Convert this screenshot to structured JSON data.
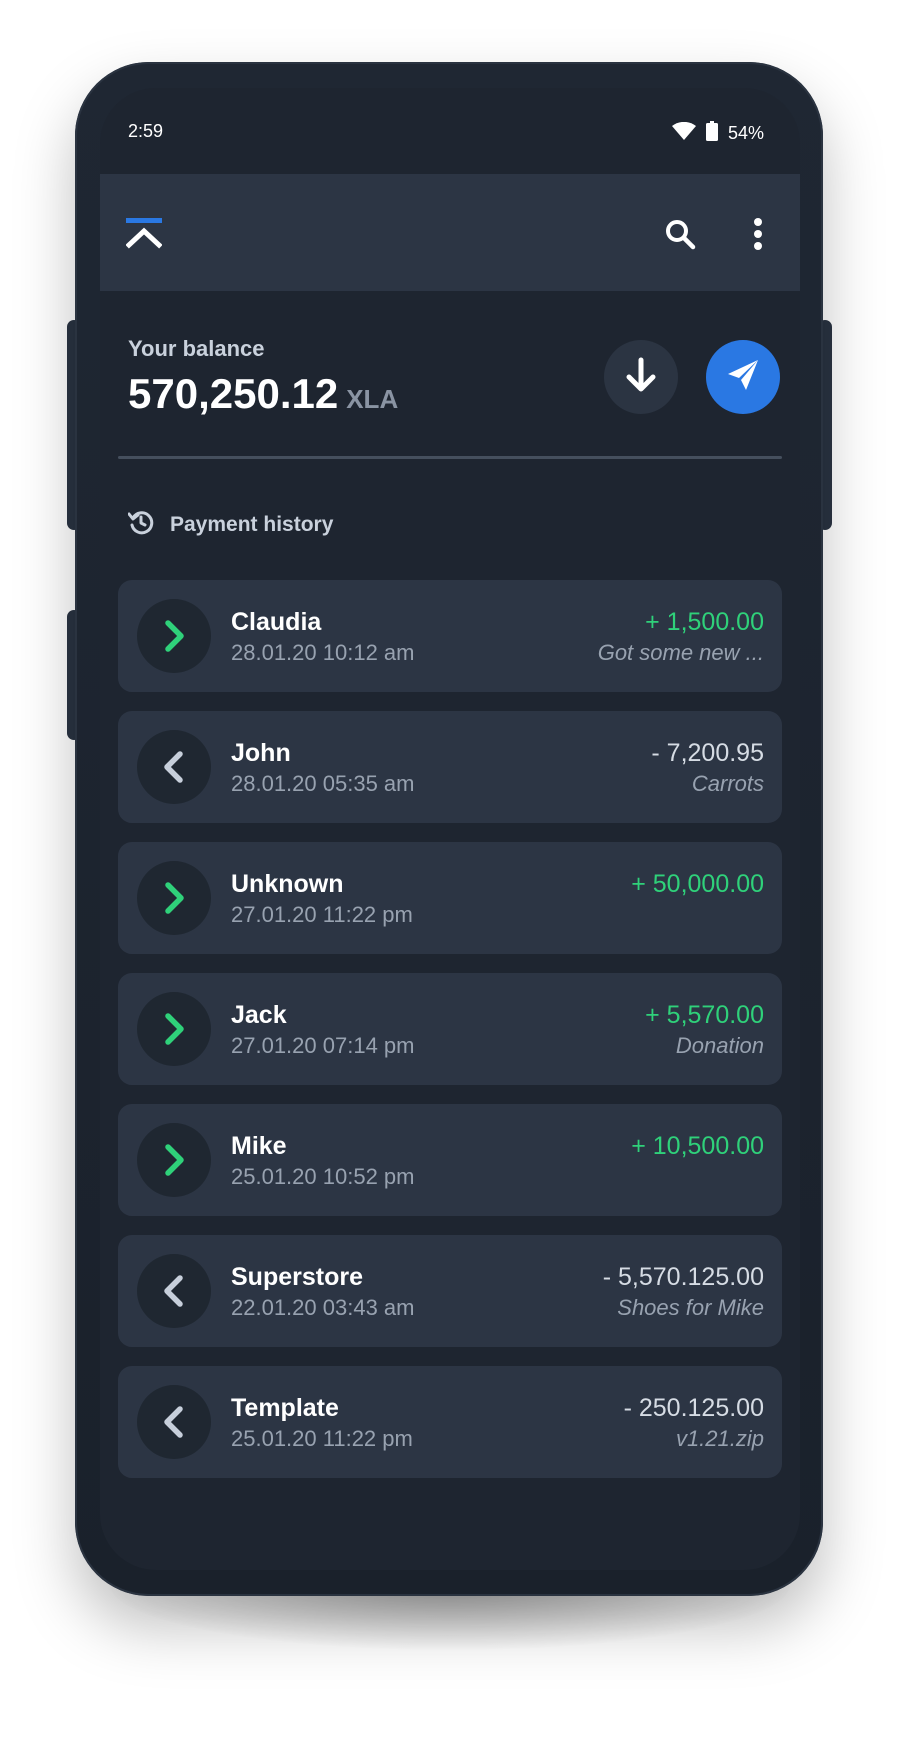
{
  "status_bar": {
    "time": "2:59",
    "battery": "54%"
  },
  "app_bar": {
    "logo": "chevron-up-logo",
    "icons": [
      "search-icon",
      "more-vert-icon"
    ]
  },
  "balance": {
    "label": "Your balance",
    "amount": "570,250.12",
    "currency": "XLA"
  },
  "actions": {
    "receive_icon": "arrow-down-icon",
    "send_icon": "paper-plane-icon"
  },
  "history": {
    "title": "Payment history",
    "icon": "history-icon",
    "items": [
      {
        "direction": "in",
        "name": "Claudia",
        "date": "28.01.20 10:12 am",
        "amount": "+ 1,500.00",
        "note": "Got some new ..."
      },
      {
        "direction": "out",
        "name": "John",
        "date": "28.01.20 05:35 am",
        "amount": "- 7,200.95",
        "note": "Carrots"
      },
      {
        "direction": "in",
        "name": "Unknown",
        "date": "27.01.20 11:22 pm",
        "amount": "+ 50,000.00",
        "note": ""
      },
      {
        "direction": "in",
        "name": "Jack",
        "date": "27.01.20 07:14 pm",
        "amount": "+ 5,570.00",
        "note": "Donation"
      },
      {
        "direction": "in",
        "name": "Mike",
        "date": "25.01.20 10:52 pm",
        "amount": "+ 10,500.00",
        "note": ""
      },
      {
        "direction": "out",
        "name": "Superstore",
        "date": "22.01.20 03:43 am",
        "amount": "- 5,570.125.00",
        "note": "Shoes for Mike"
      },
      {
        "direction": "out",
        "name": "Template",
        "date": "25.01.20 11:22 pm",
        "amount": "- 250.125.00",
        "note": "v1.21.zip"
      }
    ]
  },
  "colors": {
    "accent": "#2a78e3",
    "incoming": "#2fd17a",
    "outgoing_icon": "#c7cfdb",
    "background": "#1e2530",
    "card": "#2c3544"
  }
}
